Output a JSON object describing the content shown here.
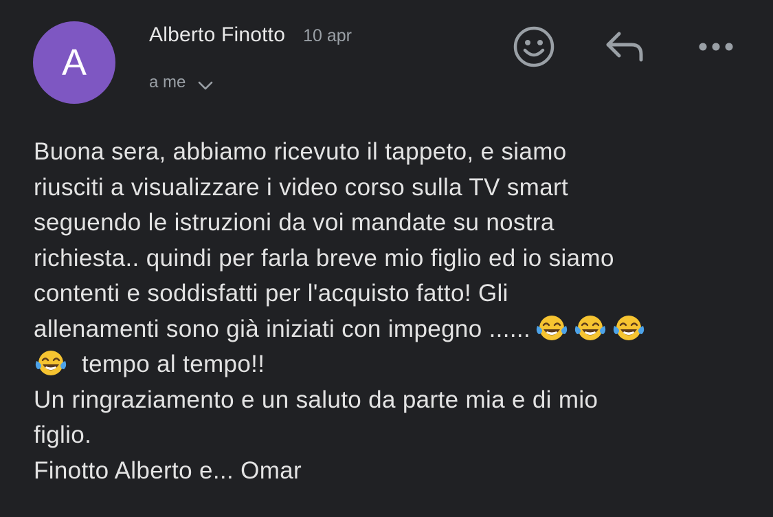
{
  "header": {
    "avatar_letter": "A",
    "sender_name": "Alberto Finotto",
    "date": "10 apr",
    "recipient": "a me"
  },
  "actions": {
    "emoji_icon": "smiley-face-icon",
    "reply_icon": "reply-arrow-icon",
    "more_icon": "more-horizontal-icon"
  },
  "colors": {
    "background": "#202124",
    "avatar": "#7e57c2",
    "text_primary": "#e3e3e3",
    "text_secondary": "#9aa0a6"
  },
  "message": {
    "line1": "Buona sera, abbiamo ricevuto il tappeto, e siamo",
    "line2": "riusciti a visualizzare i video corso sulla TV smart",
    "line3": "seguendo le istruzioni da voi mandate su nostra",
    "line4": "richiesta.. quindi per farla breve mio figlio ed io siamo",
    "line5": "contenti e soddisfatti per l'acquisto fatto! Gli",
    "line6": "allenamenti sono già iniziati con impegno ......",
    "line7": "tempo al tempo!!",
    "line8": "Un ringraziamento e un saluto da parte mia e di mio",
    "line9": "figlio.",
    "line10": "Finotto Alberto e... Omar",
    "emoji_name": "face-with-tears-of-joy"
  }
}
